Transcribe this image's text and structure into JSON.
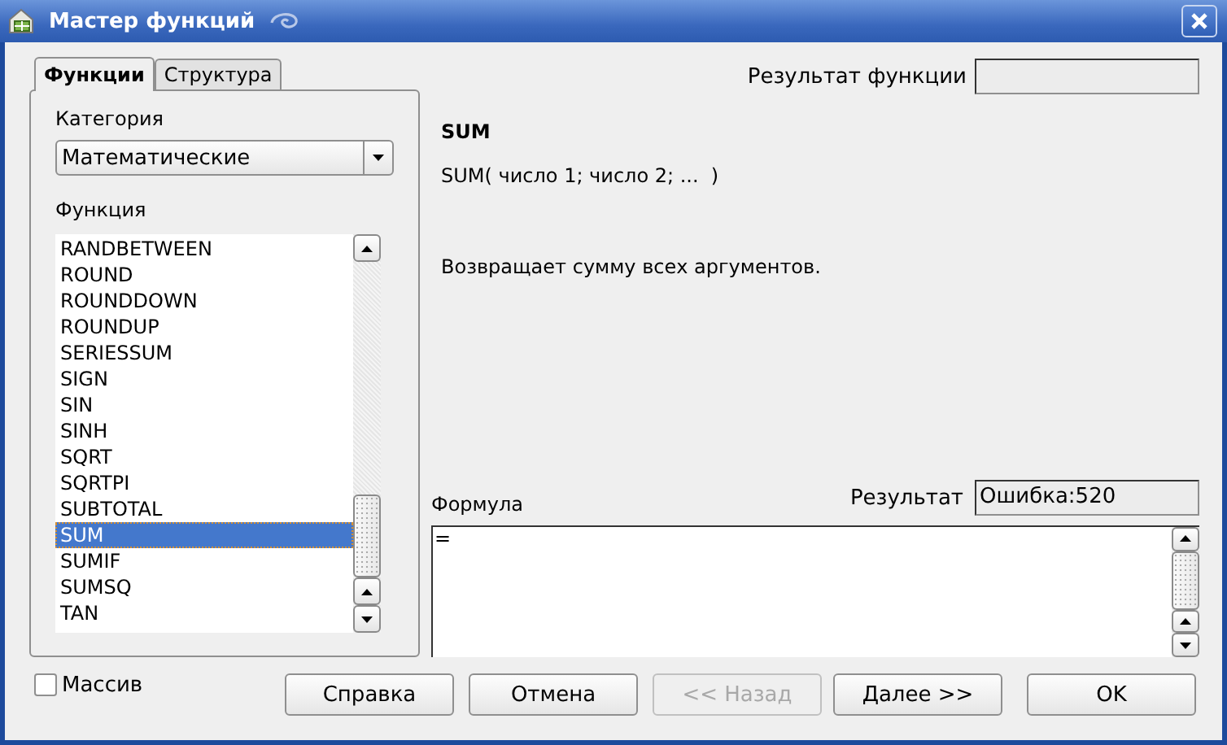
{
  "window": {
    "title": "Мастер функций"
  },
  "tabs": [
    {
      "label": "Функции",
      "selected": true
    },
    {
      "label": "Структура",
      "selected": false
    }
  ],
  "function_result": {
    "label": "Результат функции"
  },
  "category": {
    "label": "Категория",
    "value": "Математические"
  },
  "function_list": {
    "label": "Функция",
    "items": [
      {
        "label": "RANDBETWEEN",
        "selected": false
      },
      {
        "label": "ROUND",
        "selected": false
      },
      {
        "label": "ROUNDDOWN",
        "selected": false
      },
      {
        "label": "ROUNDUP",
        "selected": false
      },
      {
        "label": "SERIESSUM",
        "selected": false
      },
      {
        "label": "SIGN",
        "selected": false
      },
      {
        "label": "SIN",
        "selected": false
      },
      {
        "label": "SINH",
        "selected": false
      },
      {
        "label": "SQRT",
        "selected": false
      },
      {
        "label": "SQRTPI",
        "selected": false
      },
      {
        "label": "SUBTOTAL",
        "selected": false
      },
      {
        "label": "SUM",
        "selected": true
      },
      {
        "label": "SUMIF",
        "selected": false
      },
      {
        "label": "SUMSQ",
        "selected": false
      },
      {
        "label": "TAN",
        "selected": false
      }
    ]
  },
  "function_info": {
    "name": "SUM",
    "syntax": "SUM( число 1; число 2; ...  )",
    "description": "Возвращает сумму всех аргументов."
  },
  "result": {
    "label": "Результат",
    "value": "Ошибка:520"
  },
  "formula": {
    "label": "Формула",
    "value": "="
  },
  "array_checkbox": {
    "label": "Массив",
    "checked": false
  },
  "buttons": [
    {
      "label": "Справка",
      "disabled": false
    },
    {
      "label": "Отмена",
      "disabled": false
    },
    {
      "label": "<< Назад",
      "disabled": true
    },
    {
      "label": "Далее >>",
      "disabled": false
    },
    {
      "label": "OK",
      "disabled": false
    }
  ]
}
